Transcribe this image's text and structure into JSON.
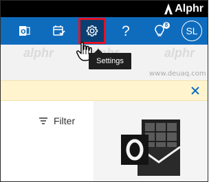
{
  "header": {
    "brand": "Alphr"
  },
  "toolbar": {
    "items": [
      {
        "icon": "outlook-icon"
      },
      {
        "icon": "calendar-check-icon"
      },
      {
        "icon": "gear-icon"
      },
      {
        "label": "?",
        "icon": "help-icon"
      },
      {
        "icon": "lightbulb-icon",
        "badge": "8"
      }
    ],
    "avatar_initials": "SL"
  },
  "tooltip": {
    "text": "Settings"
  },
  "filter": {
    "label": "Filter"
  },
  "watermarks": {
    "alphr": "alphr",
    "site": "www.deuaq.com"
  },
  "colors": {
    "ribbon": "#0f6cbd",
    "settings_active": "#0a3f73",
    "highlight_border": "#e81123",
    "notice_bg": "#fff4ce",
    "close_icon": "#0f6cbd"
  }
}
